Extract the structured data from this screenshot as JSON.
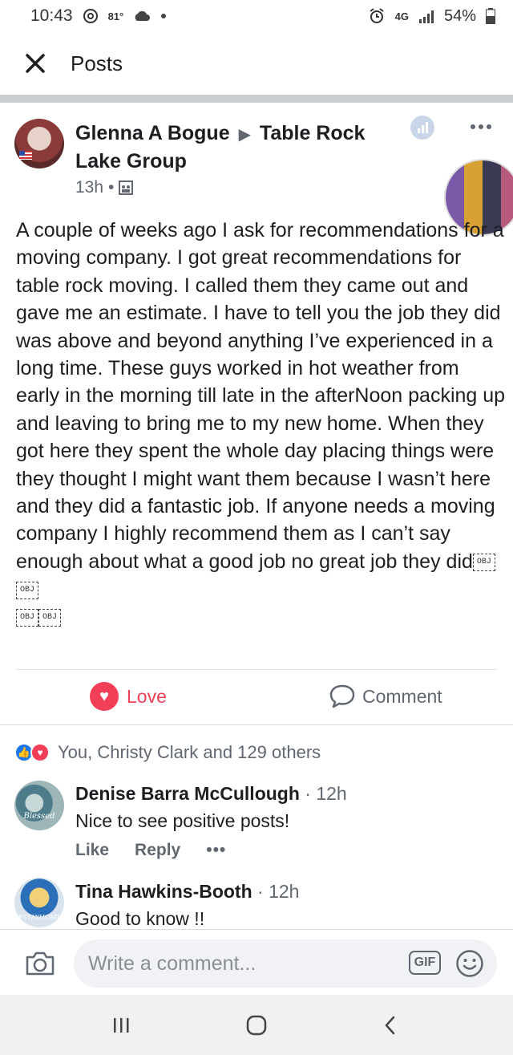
{
  "status_bar": {
    "time": "10:43",
    "temperature": "81°",
    "network": "4G",
    "battery": "54%"
  },
  "header": {
    "title": "Posts"
  },
  "post": {
    "author": "Glenna A Bogue",
    "group": "Table Rock Lake Group",
    "time": "13h",
    "body": "A couple of weeks ago I ask for recommendations for a moving company. I got great recommendations for table rock moving. I called them they came out and gave me an estimate. I have to tell you the job they did was above and beyond anything I’ve experienced in a long time. These guys worked in hot weather from early in the morning till late in the afterNoon packing up and leaving to bring me to my new home. When they got here they spent the whole day placing things were they thought I might want them because I wasn’t here and they did a fantastic job. If anyone needs a moving company I highly recommend them as I can’t say enough about what a good job no great job they did",
    "obj_placeholder": "OBJ"
  },
  "actions": {
    "love_label": "Love",
    "comment_label": "Comment"
  },
  "reactions": {
    "summary": "You, Christy Clark and 129 others"
  },
  "comments": [
    {
      "name": "Denise Barra McCullough",
      "time": "· 12h",
      "text": "Nice to see positive posts!",
      "avatar_text": "Blessed",
      "like_label": "Like",
      "reply_label": "Reply",
      "more_label": "•••"
    },
    {
      "name": "Tina Hawkins-Booth",
      "time": "· 12h",
      "text": "Good to know !!",
      "avatar_text": "#STAYHOME"
    }
  ],
  "composer": {
    "placeholder": "Write a comment...",
    "gif_label": "GIF"
  },
  "colors": {
    "love": "#f33e58",
    "facebook_blue": "#1877f2",
    "secondary_text": "#606770"
  }
}
